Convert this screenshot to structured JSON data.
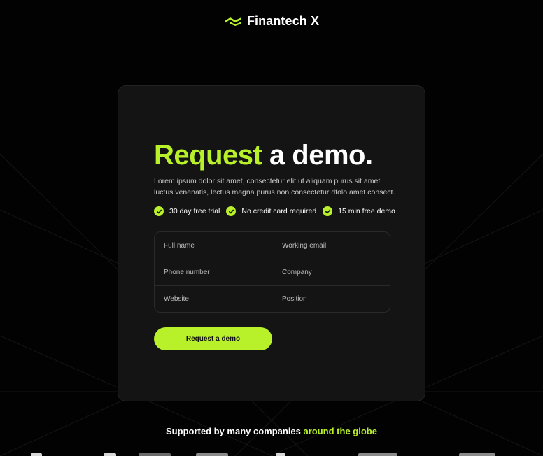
{
  "brand": {
    "name": "Finantech X",
    "logo_icon": "chevron-stack-icon",
    "accent_color": "#b8f02a"
  },
  "hero": {
    "title_accent": "Request",
    "title_rest": "a demo.",
    "description": "Lorem ipsum dolor sit amet, consectetur elit ut aliquam purus sit amet luctus venenatis, lectus magna purus non consectetur dfolo amet consect."
  },
  "features": [
    {
      "label": "30 day free trial",
      "icon": "check-circle-icon"
    },
    {
      "label": "No credit card required",
      "icon": "check-circle-icon"
    },
    {
      "label": "15 min free demo",
      "icon": "check-circle-icon"
    }
  ],
  "form": {
    "fields": [
      {
        "placeholder": "Full name",
        "value": ""
      },
      {
        "placeholder": "Working email",
        "value": ""
      },
      {
        "placeholder": "Phone number",
        "value": ""
      },
      {
        "placeholder": "Company",
        "value": ""
      },
      {
        "placeholder": "Website",
        "value": ""
      },
      {
        "placeholder": "Position",
        "value": ""
      }
    ],
    "submit_label": "Request a demo"
  },
  "footer": {
    "support_text": "Supported by many companies",
    "support_accent": "around the globe",
    "partner_logos": [
      "partner-logo-1",
      "partner-logo-2",
      "partner-logo-3",
      "partner-logo-4",
      "partner-logo-5",
      "partner-logo-6",
      "partner-logo-7"
    ]
  },
  "colors": {
    "background": "#020202",
    "card": "#141414",
    "accent": "#b8f02a"
  }
}
